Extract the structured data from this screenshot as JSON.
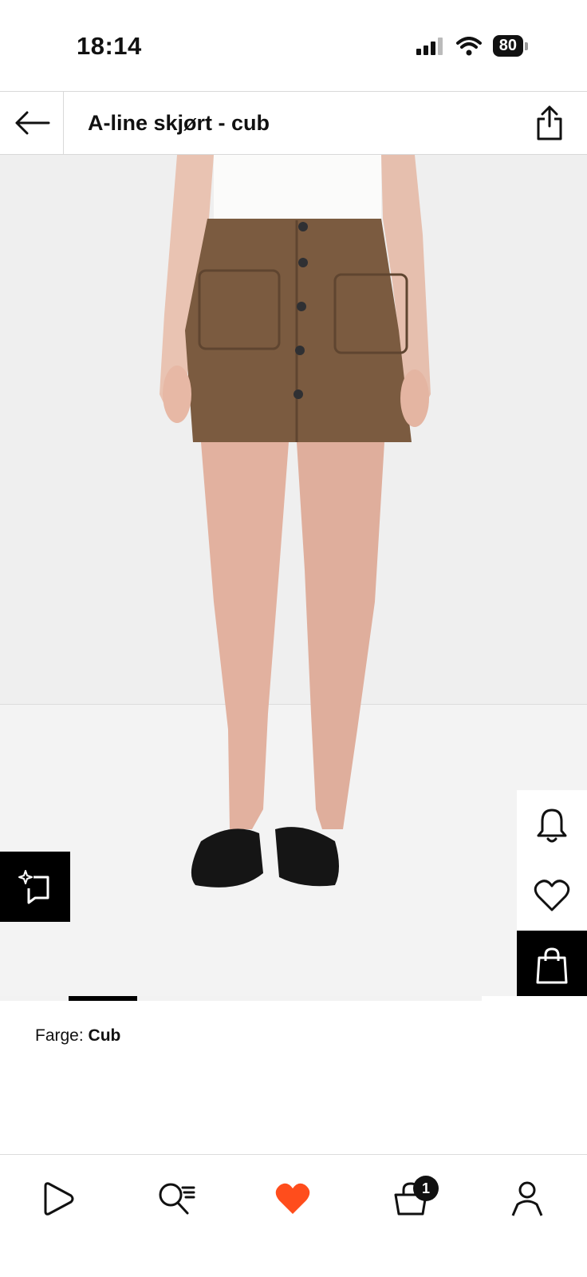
{
  "status_bar": {
    "time": "18:14",
    "battery": "80"
  },
  "header": {
    "title": "A-line skjørt - cub"
  },
  "color_section": {
    "label": "Farge:",
    "selected_color": "Cub",
    "swatches": [
      {
        "color": "#7b5b40"
      },
      {
        "color": "#8a3e30"
      },
      {
        "color": "#2f3a2f"
      },
      {
        "color": "#c9741f"
      }
    ]
  },
  "bottom_nav": {
    "cart_count": "1",
    "accent": "#ff4d1c"
  },
  "colors": {
    "skirt": "#7b5b40",
    "accent": "#ff4d1c",
    "icon": "#111111"
  }
}
